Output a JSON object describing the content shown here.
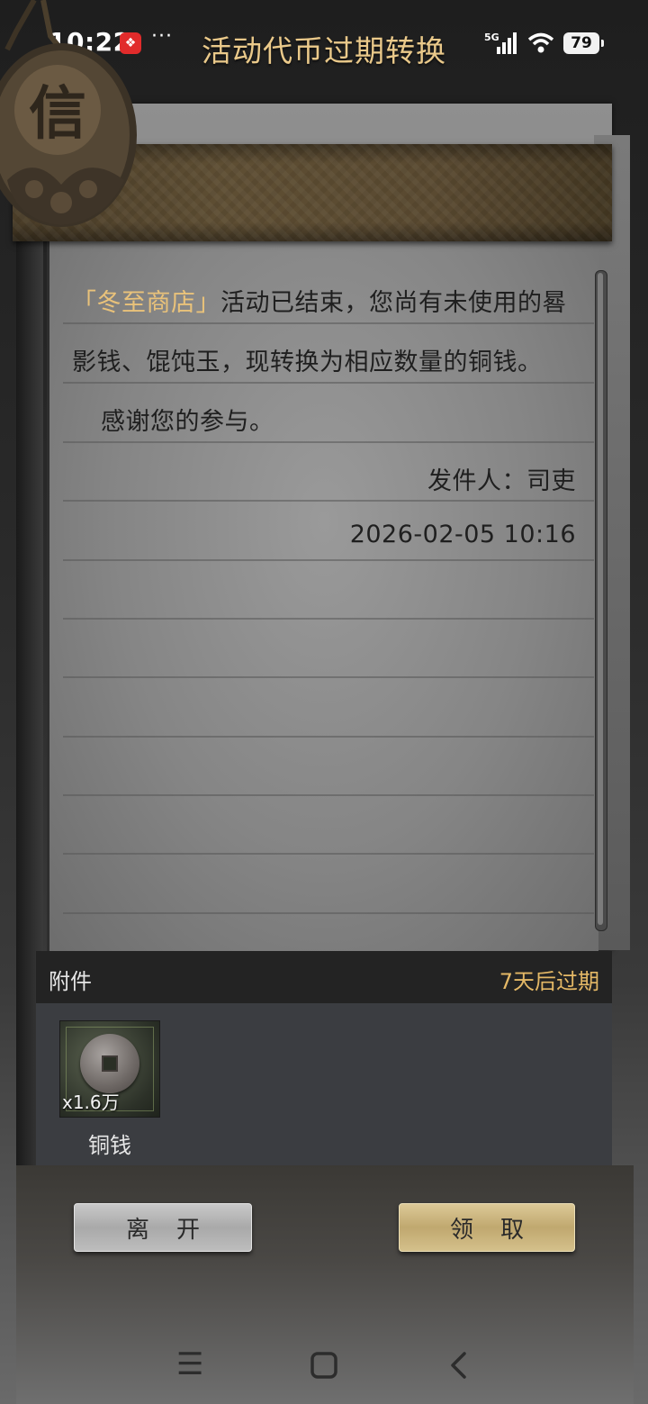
{
  "status_bar": {
    "time": "10:22",
    "notification_icon": "app-notification-icon",
    "more": "···",
    "network": "5G",
    "battery": "79"
  },
  "mail": {
    "title": "活动代币过期转换",
    "body_line1_highlight": "「冬至商店」",
    "body_line1_rest": "活动已结束，您尚有未使用的晷",
    "body_line2": "影钱、馄饨玉，现转换为相应数量的铜钱。",
    "body_line3": "感谢您的参与。",
    "sender": "发件人：司吏",
    "date": "2026-02-05 10:16"
  },
  "attachments": {
    "label": "附件",
    "expire_text": "7天后过期",
    "items": [
      {
        "name": "铜钱",
        "quantity": "x1.6万",
        "icon": "copper-coin-icon"
      }
    ]
  },
  "buttons": {
    "leave": "离开",
    "claim": "领取"
  },
  "nav": {
    "menu_icon": "☰",
    "home_icon": "▢",
    "back_icon": "‹"
  },
  "colors": {
    "title": "#eac98a",
    "highlight": "#e9c27a",
    "expire": "#e4b866"
  }
}
